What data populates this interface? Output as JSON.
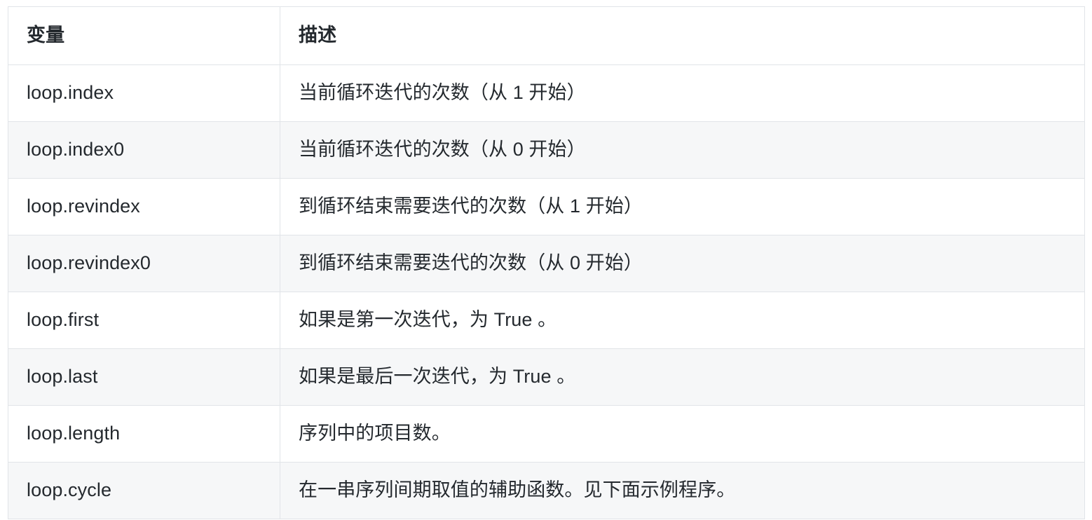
{
  "table": {
    "headers": [
      {
        "label": "变量"
      },
      {
        "label": "描述"
      }
    ],
    "rows": [
      {
        "variable": "loop.index",
        "description": "当前循环迭代的次数（从 1 开始）"
      },
      {
        "variable": "loop.index0",
        "description": "当前循环迭代的次数（从 0 开始）"
      },
      {
        "variable": "loop.revindex",
        "description": "到循环结束需要迭代的次数（从 1 开始）"
      },
      {
        "variable": "loop.revindex0",
        "description": "到循环结束需要迭代的次数（从 0 开始）"
      },
      {
        "variable": "loop.first",
        "description": "如果是第一次迭代，为 True 。"
      },
      {
        "variable": "loop.last",
        "description": "如果是最后一次迭代，为 True 。"
      },
      {
        "variable": "loop.length",
        "description": "序列中的项目数。"
      },
      {
        "variable": "loop.cycle",
        "description": "在一串序列间期取值的辅助函数。见下面示例程序。"
      }
    ]
  },
  "colors": {
    "border": "#e1e4e8",
    "row_alt_background": "#f6f7f8",
    "row_background": "#ffffff",
    "text": "#24292e"
  }
}
